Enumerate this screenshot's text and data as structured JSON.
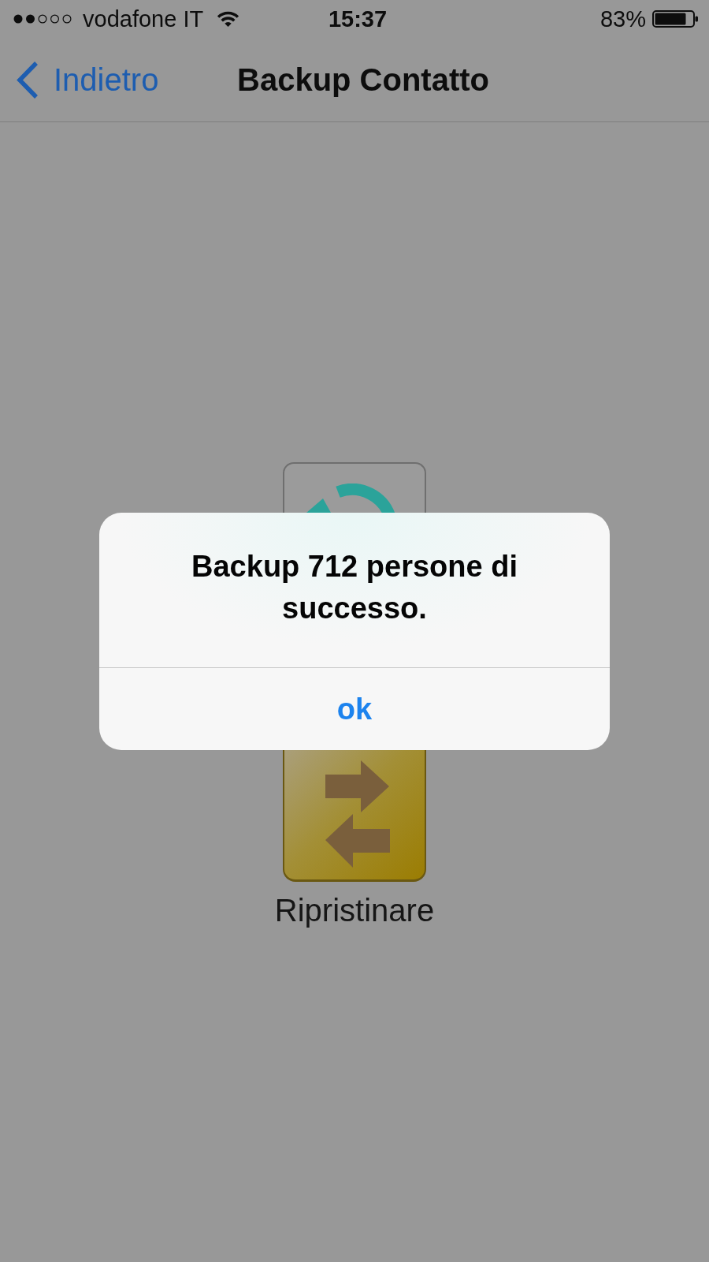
{
  "status_bar": {
    "carrier": "vodafone IT",
    "time": "15:37",
    "battery": "83%"
  },
  "nav_bar": {
    "back": "Indietro",
    "title": "Backup Contatto"
  },
  "tiles": [
    {
      "kind": "backup"
    },
    {
      "kind": "restore",
      "label": "Ripristinare"
    }
  ],
  "alert": {
    "message": "Backup 712 persone di successo.",
    "buttons": [
      "ok"
    ]
  }
}
